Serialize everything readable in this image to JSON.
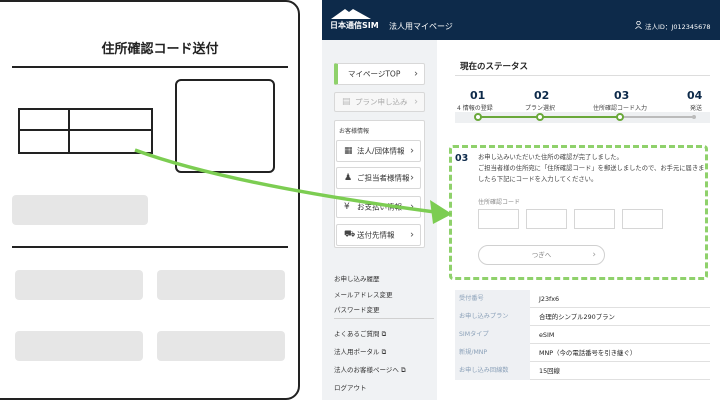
{
  "card": {
    "title": "住所確認コード送付"
  },
  "header": {
    "logo": "日本通信SIM",
    "portal_title": "法人用マイページ",
    "user_id": "法人ID：J012345678"
  },
  "sidebar": {
    "top_button": "マイページTOP",
    "plan_button": "プラン申し込み",
    "section_label": "お客様情報",
    "items": [
      {
        "label": "法人/団体情報",
        "icon": "building-icon"
      },
      {
        "label": "ご担当者様情報",
        "icon": "person-icon"
      },
      {
        "label": "お支払い情報",
        "icon": "yen-icon"
      },
      {
        "label": "送付先情報",
        "icon": "truck-icon"
      }
    ],
    "links": [
      "お申し込み履歴",
      "メールアドレス変更",
      "パスワード変更"
    ],
    "links2": [
      "よくあるご質問",
      "法人用ポータル",
      "法人のお客様ページへ",
      "ログアウト"
    ]
  },
  "status": {
    "heading": "現在のステータス",
    "steps": [
      {
        "num": "01",
        "label": "4 情報の登録"
      },
      {
        "num": "02",
        "label": "プラン選択"
      },
      {
        "num": "03",
        "label": "住所確認コード入力"
      },
      {
        "num": "04",
        "label": "発送"
      }
    ]
  },
  "step3": {
    "num": "03",
    "message_lines": [
      "お申し込みいただいた住所の確認が完了しました。",
      "ご担当者様の住所宛に「住所確認コード」を郵送しましたので、お手元に届きま",
      "したら下記にコードを入力してください。"
    ],
    "code_label": "住所確認コード",
    "next_button": "つぎへ"
  },
  "details": [
    {
      "key": "受付番号",
      "value": "J23fx6"
    },
    {
      "key": "お申し込みプラン",
      "value": "合理的シンプル290プラン"
    },
    {
      "key": "SIMタイプ",
      "value": "eSIM"
    },
    {
      "key": "新規/MNP",
      "value": "MNP（今の電話番号を引き継ぐ）"
    },
    {
      "key": "お申し込み回線数",
      "value": "15回線"
    }
  ],
  "colors": {
    "navy": "#0d2a4a",
    "accent_green": "#6aa83a",
    "highlight_green": "#8fd16b"
  }
}
